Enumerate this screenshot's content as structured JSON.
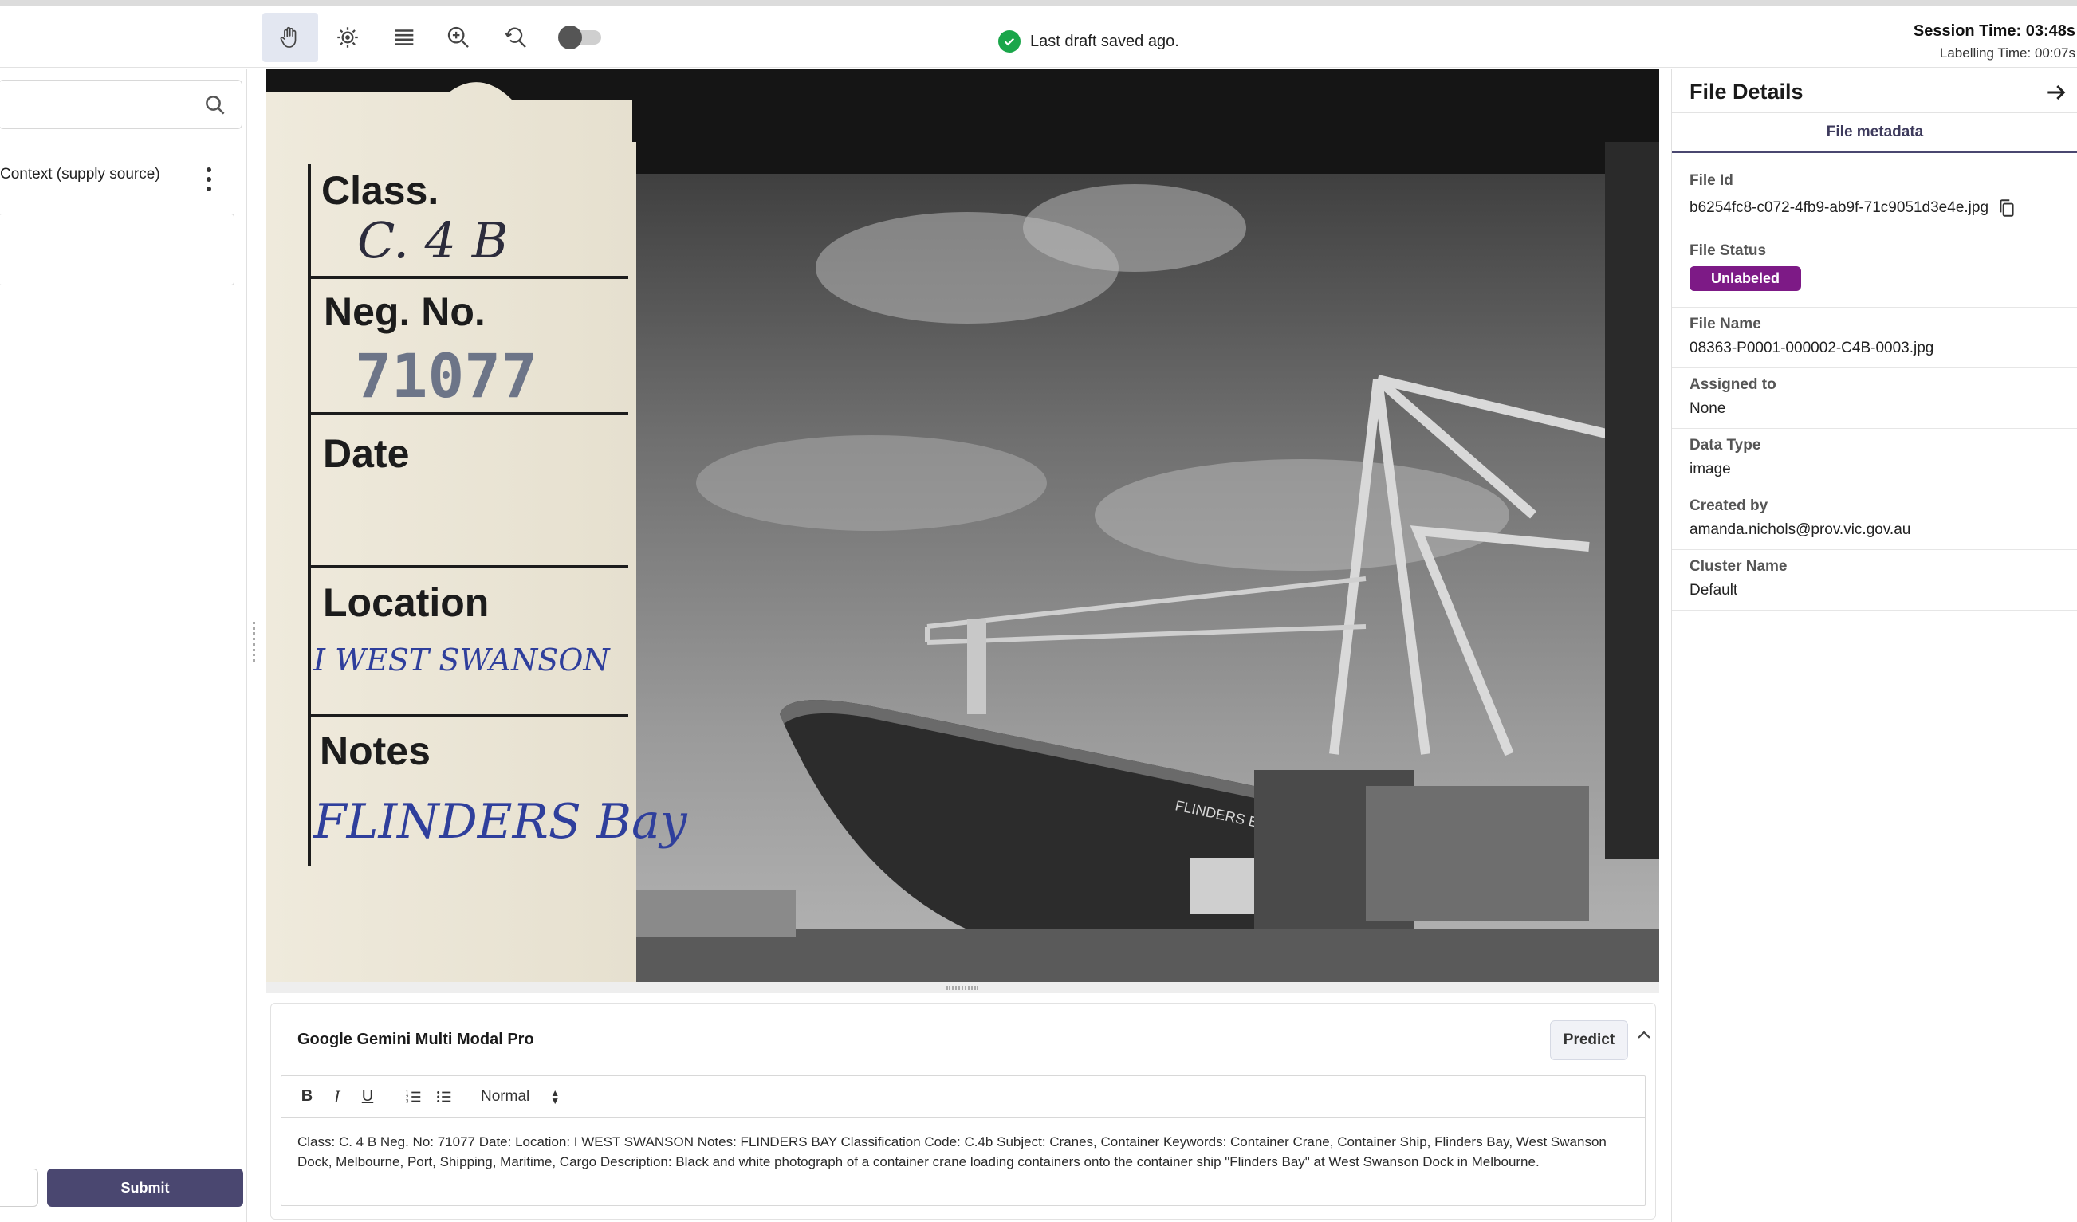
{
  "toolbar": {
    "tools": [
      "pan-tool",
      "brightness-tool",
      "layers-tool",
      "zoom-in-tool",
      "zoom-reset-tool"
    ],
    "save_status": "Last draft saved ago.",
    "session_time": "Session Time: 03:48s",
    "labelling_time": "Labelling Time: 00:07s"
  },
  "left_panel": {
    "search": {
      "placeholder": ""
    },
    "context_label": "Context (supply source)",
    "submit_label": "Submit"
  },
  "image_card": {
    "class_label": "Class.",
    "class_value": "C. 4 B",
    "neg_label": "Neg. No.",
    "neg_value": "71077",
    "date_label": "Date",
    "location_label": "Location",
    "location_value": "I WEST SWANSON",
    "notes_label": "Notes",
    "notes_value": "FLINDERS Bay",
    "ship_name": "FLINDERS BAY"
  },
  "prediction": {
    "model_title": "Google Gemini Multi Modal Pro",
    "predict_label": "Predict",
    "format_value": "Normal",
    "text": "Class: C. 4 B Neg. No: 71077 Date: Location: I WEST SWANSON Notes: FLINDERS BAY Classification Code: C.4b Subject: Cranes, Container Keywords: Container Crane, Container Ship, Flinders Bay, West Swanson Dock, Melbourne, Port, Shipping, Maritime, Cargo Description: Black and white photograph of a container crane loading containers onto the container ship \"Flinders Bay\" at West Swanson Dock in Melbourne."
  },
  "file_details": {
    "title": "File Details",
    "tab": "File metadata",
    "fields": [
      {
        "label": "File Id",
        "value": "b6254fc8-c072-4fb9-ab9f-71c9051d3e4e.jpg"
      },
      {
        "label": "File Status",
        "value": "Unlabeled"
      },
      {
        "label": "File Name",
        "value": "08363-P0001-000002-C4B-0003.jpg"
      },
      {
        "label": "Assigned to",
        "value": "None"
      },
      {
        "label": "Data Type",
        "value": "image"
      },
      {
        "label": "Created by",
        "value": "amanda.nichols@prov.vic.gov.au"
      },
      {
        "label": "Cluster Name",
        "value": "Default"
      }
    ]
  },
  "colors": {
    "accent": "#4a4770",
    "status_badge": "#7d1a86",
    "saved_check": "#1aa64a",
    "active_tool_bg": "#e3e7f1"
  }
}
